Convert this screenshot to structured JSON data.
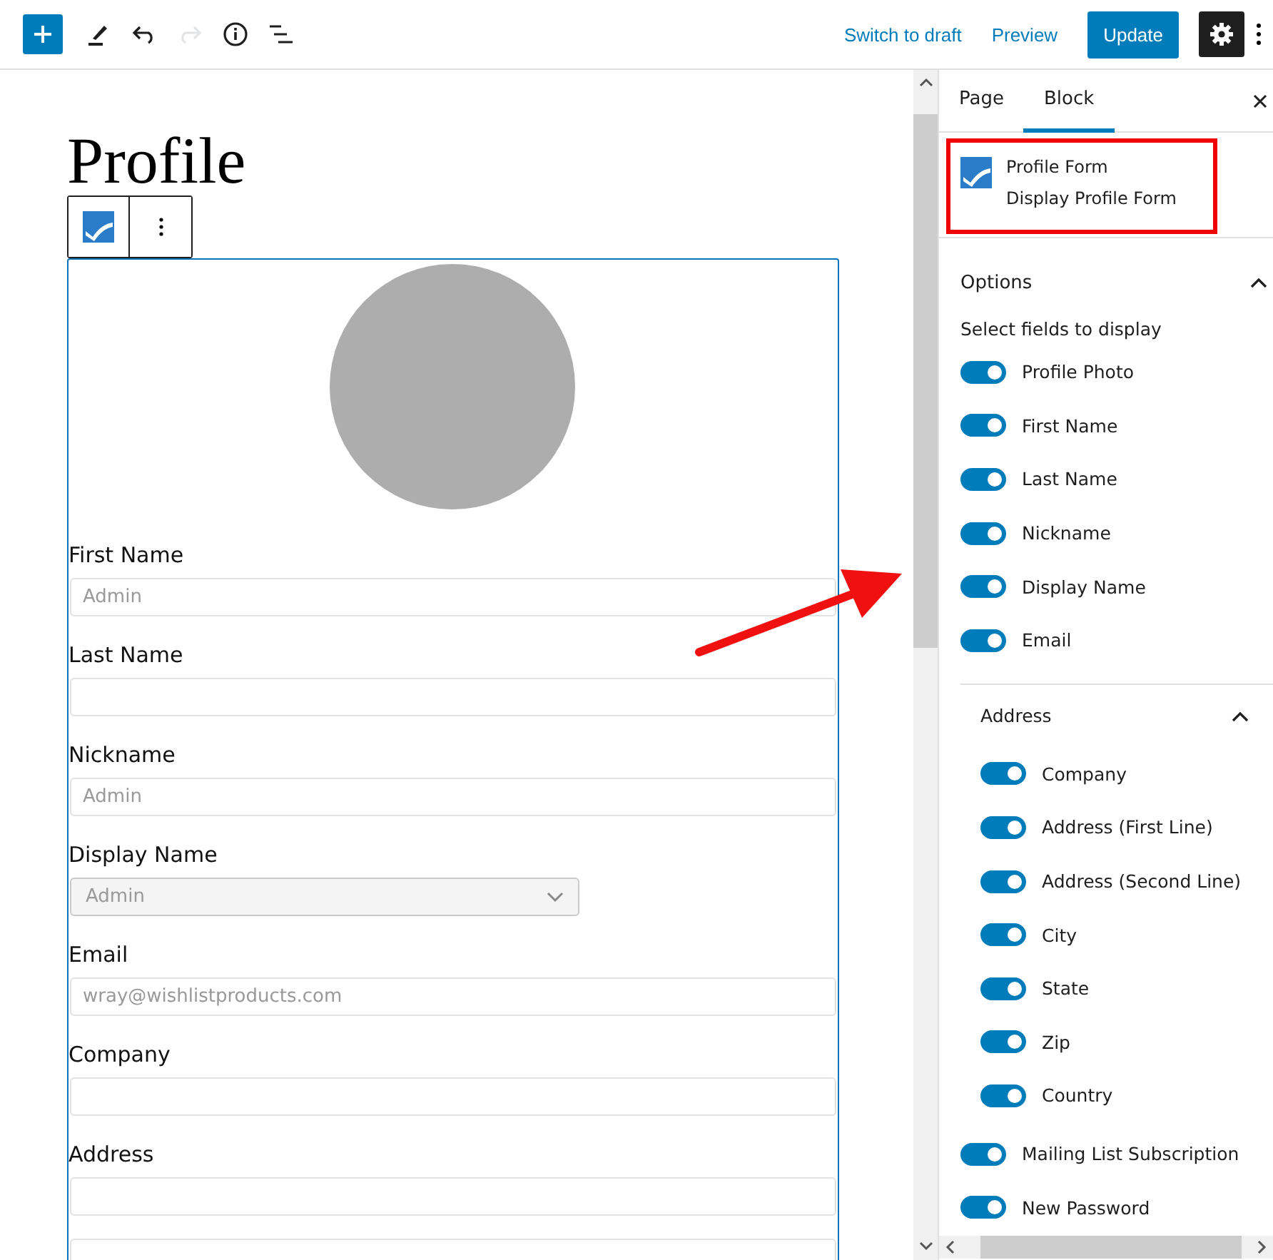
{
  "toolbar": {
    "tools": [
      {
        "kind": "add",
        "disabled": false
      },
      {
        "kind": "edit",
        "disabled": false
      },
      {
        "kind": "undo",
        "disabled": false
      },
      {
        "kind": "redo",
        "disabled": true
      },
      {
        "kind": "info",
        "disabled": false
      },
      {
        "kind": "outline",
        "disabled": false
      }
    ],
    "links": [
      "Switch to draft",
      "Preview"
    ],
    "primary": "Update",
    "settings_pressed": true
  },
  "editor": {
    "title": "Profile",
    "form": [
      {
        "label": "First Name",
        "kind": "input",
        "value": "Admin"
      },
      {
        "label": "Last Name",
        "kind": "input"
      },
      {
        "label": "Nickname",
        "kind": "input",
        "value": "Admin"
      },
      {
        "label": "Display Name",
        "kind": "select",
        "value": "Admin"
      },
      {
        "label": "Email",
        "kind": "input",
        "value": "wray@wishlistproducts.com"
      },
      {
        "label": "Company",
        "kind": "input"
      },
      {
        "label": "Address",
        "kind": "input2"
      }
    ]
  },
  "annotation": {
    "highlight": true,
    "arrow": true
  },
  "sidebar": {
    "tabs": [
      {
        "label": "Page",
        "selected": false
      },
      {
        "label": "Block",
        "selected": true
      }
    ],
    "block": {
      "title": "Profile Form",
      "description": "Display Profile Form"
    },
    "panel": {
      "title": "Options",
      "expanded": true,
      "hint": "Select fields to display",
      "fields": [
        {
          "kind": "toggle",
          "label": "Profile Photo",
          "on": true
        },
        {
          "kind": "toggle",
          "label": "First Name",
          "on": true
        },
        {
          "kind": "toggle",
          "label": "Last Name",
          "on": true
        },
        {
          "kind": "toggle",
          "label": "Nickname",
          "on": true
        },
        {
          "kind": "toggle",
          "label": "Display Name",
          "on": true
        },
        {
          "kind": "toggle",
          "label": "Email",
          "on": true
        },
        {
          "kind": "group",
          "label": "Address",
          "expanded": true,
          "children": [
            {
              "kind": "toggle",
              "label": "Company",
              "on": true
            },
            {
              "kind": "toggle",
              "label": "Address (First Line)",
              "on": true
            },
            {
              "kind": "toggle",
              "label": "Address (Second Line)",
              "on": true
            },
            {
              "kind": "toggle",
              "label": "City",
              "on": true
            },
            {
              "kind": "toggle",
              "label": "State",
              "on": true
            },
            {
              "kind": "toggle",
              "label": "Zip",
              "on": true
            },
            {
              "kind": "toggle",
              "label": "Country",
              "on": true
            }
          ]
        },
        {
          "kind": "toggle",
          "label": "Mailing List Subscription",
          "on": true
        },
        {
          "kind": "toggle",
          "label": "New Password",
          "on": true
        }
      ]
    }
  }
}
